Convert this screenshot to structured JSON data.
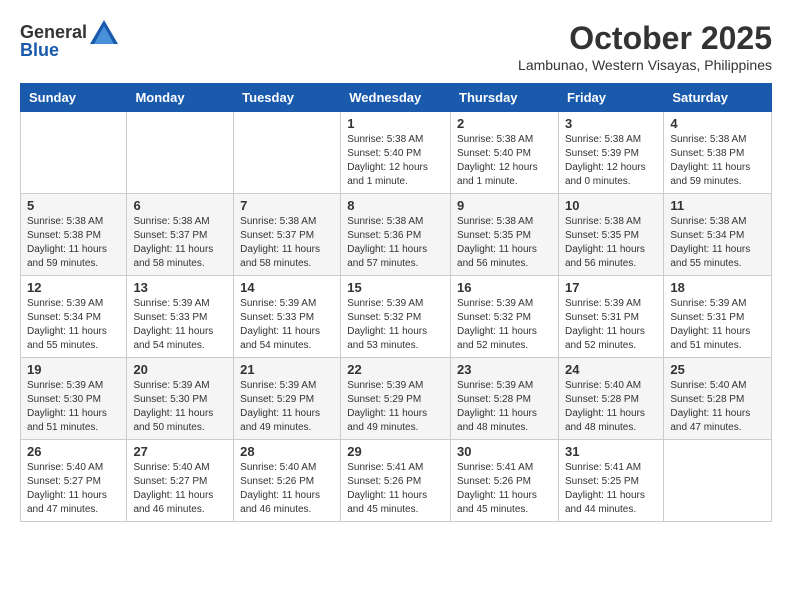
{
  "header": {
    "logo_general": "General",
    "logo_blue": "Blue",
    "month_year": "October 2025",
    "location": "Lambunao, Western Visayas, Philippines"
  },
  "days_of_week": [
    "Sunday",
    "Monday",
    "Tuesday",
    "Wednesday",
    "Thursday",
    "Friday",
    "Saturday"
  ],
  "weeks": [
    [
      {
        "day": "",
        "content": ""
      },
      {
        "day": "",
        "content": ""
      },
      {
        "day": "",
        "content": ""
      },
      {
        "day": "1",
        "content": "Sunrise: 5:38 AM\nSunset: 5:40 PM\nDaylight: 12 hours\nand 1 minute."
      },
      {
        "day": "2",
        "content": "Sunrise: 5:38 AM\nSunset: 5:40 PM\nDaylight: 12 hours\nand 1 minute."
      },
      {
        "day": "3",
        "content": "Sunrise: 5:38 AM\nSunset: 5:39 PM\nDaylight: 12 hours\nand 0 minutes."
      },
      {
        "day": "4",
        "content": "Sunrise: 5:38 AM\nSunset: 5:38 PM\nDaylight: 11 hours\nand 59 minutes."
      }
    ],
    [
      {
        "day": "5",
        "content": "Sunrise: 5:38 AM\nSunset: 5:38 PM\nDaylight: 11 hours\nand 59 minutes."
      },
      {
        "day": "6",
        "content": "Sunrise: 5:38 AM\nSunset: 5:37 PM\nDaylight: 11 hours\nand 58 minutes."
      },
      {
        "day": "7",
        "content": "Sunrise: 5:38 AM\nSunset: 5:37 PM\nDaylight: 11 hours\nand 58 minutes."
      },
      {
        "day": "8",
        "content": "Sunrise: 5:38 AM\nSunset: 5:36 PM\nDaylight: 11 hours\nand 57 minutes."
      },
      {
        "day": "9",
        "content": "Sunrise: 5:38 AM\nSunset: 5:35 PM\nDaylight: 11 hours\nand 56 minutes."
      },
      {
        "day": "10",
        "content": "Sunrise: 5:38 AM\nSunset: 5:35 PM\nDaylight: 11 hours\nand 56 minutes."
      },
      {
        "day": "11",
        "content": "Sunrise: 5:38 AM\nSunset: 5:34 PM\nDaylight: 11 hours\nand 55 minutes."
      }
    ],
    [
      {
        "day": "12",
        "content": "Sunrise: 5:39 AM\nSunset: 5:34 PM\nDaylight: 11 hours\nand 55 minutes."
      },
      {
        "day": "13",
        "content": "Sunrise: 5:39 AM\nSunset: 5:33 PM\nDaylight: 11 hours\nand 54 minutes."
      },
      {
        "day": "14",
        "content": "Sunrise: 5:39 AM\nSunset: 5:33 PM\nDaylight: 11 hours\nand 54 minutes."
      },
      {
        "day": "15",
        "content": "Sunrise: 5:39 AM\nSunset: 5:32 PM\nDaylight: 11 hours\nand 53 minutes."
      },
      {
        "day": "16",
        "content": "Sunrise: 5:39 AM\nSunset: 5:32 PM\nDaylight: 11 hours\nand 52 minutes."
      },
      {
        "day": "17",
        "content": "Sunrise: 5:39 AM\nSunset: 5:31 PM\nDaylight: 11 hours\nand 52 minutes."
      },
      {
        "day": "18",
        "content": "Sunrise: 5:39 AM\nSunset: 5:31 PM\nDaylight: 11 hours\nand 51 minutes."
      }
    ],
    [
      {
        "day": "19",
        "content": "Sunrise: 5:39 AM\nSunset: 5:30 PM\nDaylight: 11 hours\nand 51 minutes."
      },
      {
        "day": "20",
        "content": "Sunrise: 5:39 AM\nSunset: 5:30 PM\nDaylight: 11 hours\nand 50 minutes."
      },
      {
        "day": "21",
        "content": "Sunrise: 5:39 AM\nSunset: 5:29 PM\nDaylight: 11 hours\nand 49 minutes."
      },
      {
        "day": "22",
        "content": "Sunrise: 5:39 AM\nSunset: 5:29 PM\nDaylight: 11 hours\nand 49 minutes."
      },
      {
        "day": "23",
        "content": "Sunrise: 5:39 AM\nSunset: 5:28 PM\nDaylight: 11 hours\nand 48 minutes."
      },
      {
        "day": "24",
        "content": "Sunrise: 5:40 AM\nSunset: 5:28 PM\nDaylight: 11 hours\nand 48 minutes."
      },
      {
        "day": "25",
        "content": "Sunrise: 5:40 AM\nSunset: 5:28 PM\nDaylight: 11 hours\nand 47 minutes."
      }
    ],
    [
      {
        "day": "26",
        "content": "Sunrise: 5:40 AM\nSunset: 5:27 PM\nDaylight: 11 hours\nand 47 minutes."
      },
      {
        "day": "27",
        "content": "Sunrise: 5:40 AM\nSunset: 5:27 PM\nDaylight: 11 hours\nand 46 minutes."
      },
      {
        "day": "28",
        "content": "Sunrise: 5:40 AM\nSunset: 5:26 PM\nDaylight: 11 hours\nand 46 minutes."
      },
      {
        "day": "29",
        "content": "Sunrise: 5:41 AM\nSunset: 5:26 PM\nDaylight: 11 hours\nand 45 minutes."
      },
      {
        "day": "30",
        "content": "Sunrise: 5:41 AM\nSunset: 5:26 PM\nDaylight: 11 hours\nand 45 minutes."
      },
      {
        "day": "31",
        "content": "Sunrise: 5:41 AM\nSunset: 5:25 PM\nDaylight: 11 hours\nand 44 minutes."
      },
      {
        "day": "",
        "content": ""
      }
    ]
  ]
}
